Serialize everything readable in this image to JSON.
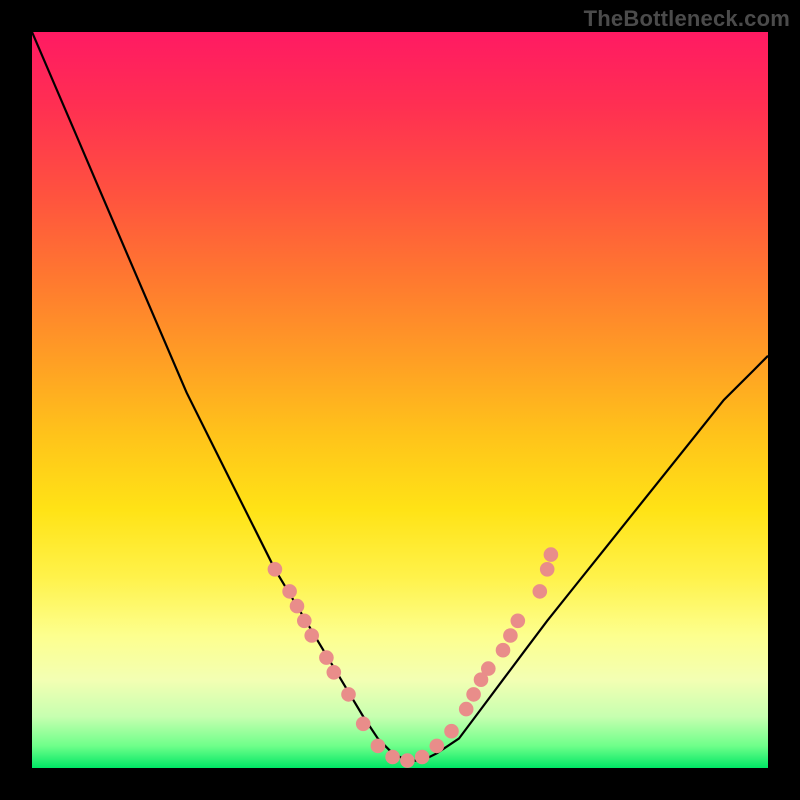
{
  "watermark": "TheBottleneck.com",
  "colors": {
    "curve_stroke": "#000000",
    "marker_fill": "#e98d8a",
    "marker_stroke": "#b55a57"
  },
  "chart_data": {
    "type": "line",
    "title": "",
    "xlabel": "",
    "ylabel": "",
    "xlim": [
      0,
      100
    ],
    "ylim": [
      0,
      100
    ],
    "x": [
      0,
      3,
      6,
      9,
      12,
      15,
      18,
      21,
      24,
      27,
      30,
      33,
      36,
      39,
      42,
      45,
      47,
      49,
      51,
      53,
      55,
      58,
      61,
      64,
      67,
      70,
      74,
      78,
      82,
      86,
      90,
      94,
      98,
      100
    ],
    "y": [
      100,
      93,
      86,
      79,
      72,
      65,
      58,
      51,
      45,
      39,
      33,
      27,
      22,
      17,
      12,
      7,
      4,
      2,
      1,
      1,
      2,
      4,
      8,
      12,
      16,
      20,
      25,
      30,
      35,
      40,
      45,
      50,
      54,
      56
    ],
    "markers": [
      {
        "x": 33,
        "y": 27
      },
      {
        "x": 35,
        "y": 24
      },
      {
        "x": 36,
        "y": 22
      },
      {
        "x": 37,
        "y": 20
      },
      {
        "x": 38,
        "y": 18
      },
      {
        "x": 40,
        "y": 15
      },
      {
        "x": 41,
        "y": 13
      },
      {
        "x": 43,
        "y": 10
      },
      {
        "x": 45,
        "y": 6
      },
      {
        "x": 47,
        "y": 3
      },
      {
        "x": 49,
        "y": 1.5
      },
      {
        "x": 51,
        "y": 1
      },
      {
        "x": 53,
        "y": 1.5
      },
      {
        "x": 55,
        "y": 3
      },
      {
        "x": 57,
        "y": 5
      },
      {
        "x": 59,
        "y": 8
      },
      {
        "x": 60,
        "y": 10
      },
      {
        "x": 61,
        "y": 12
      },
      {
        "x": 62,
        "y": 13.5
      },
      {
        "x": 64,
        "y": 16
      },
      {
        "x": 65,
        "y": 18
      },
      {
        "x": 66,
        "y": 20
      },
      {
        "x": 69,
        "y": 24
      },
      {
        "x": 70,
        "y": 27
      },
      {
        "x": 70.5,
        "y": 29
      }
    ]
  }
}
